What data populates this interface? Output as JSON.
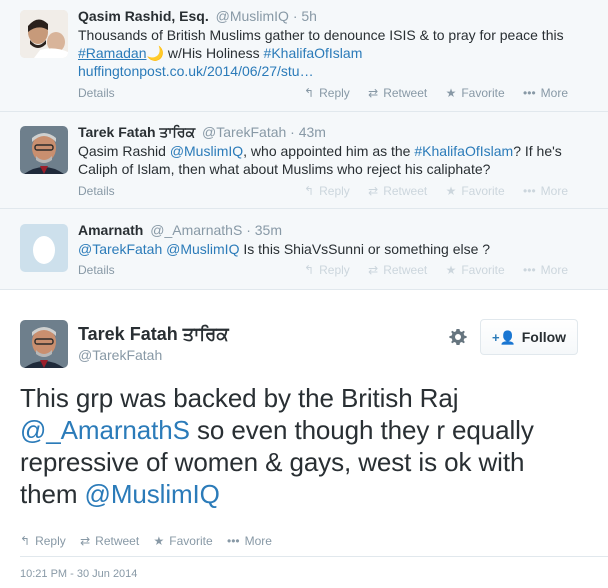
{
  "context_tweets": [
    {
      "fullname": "Qasim Rashid, Esq.",
      "screen_name": "@MuslimIQ",
      "dot": "·",
      "time": "5h",
      "text_before": "Thousands of British Muslims gather to denounce ISIS & to pray for peace this ",
      "hashtag1": "#Ramadan",
      "moon": "🌙",
      "text_mid": " w/His Holiness ",
      "hashtag2": "#KhalifaOfIslam",
      "url": "huffingtonpost.co.uk/2014/06/27/stu…",
      "details": "Details",
      "reply": "Reply",
      "retweet": "Retweet",
      "favorite": "Favorite",
      "more": "More"
    },
    {
      "fullname": "Tarek Fatah ਤਾਰਿਕ",
      "screen_name": "@TarekFatah",
      "dot": "·",
      "time": "43m",
      "text_a": "Qasim Rashid ",
      "mention1": "@MuslimIQ",
      "text_b": ", who appointed him as the ",
      "hashtag1": "#KhalifaOfIslam",
      "text_c": "? If he's Caliph of Islam, then what about Muslims who reject his caliphate?",
      "details": "Details",
      "reply": "Reply",
      "retweet": "Retweet",
      "favorite": "Favorite",
      "more": "More"
    },
    {
      "fullname": "Amarnath",
      "screen_name": "@_AmarnathS",
      "dot": "·",
      "time": "35m",
      "mention1": "@TarekFatah",
      "mention2": "@MuslimIQ",
      "text_a": " Is this ShiaVsSunni or something else ?",
      "details": "Details",
      "reply": "Reply",
      "retweet": "Retweet",
      "favorite": "Favorite",
      "more": "More"
    }
  ],
  "main_tweet": {
    "fullname": "Tarek Fatah ਤਾਰਿਕ",
    "screen_name": "@TarekFatah",
    "follow_label": "Follow",
    "text_a": "This grp was backed by the British Raj ",
    "mention1": "@_AmarnathS",
    "text_b": " so even though they r equally repressive of women & gays, west is ok with them ",
    "mention2": "@MuslimIQ",
    "reply": "Reply",
    "retweet": "Retweet",
    "favorite": "Favorite",
    "more": "More",
    "timestamp": "10:21 PM - 30 Jun 2014"
  },
  "icons": {
    "reply": "reply-icon",
    "retweet": "retweet-icon",
    "favorite": "star-icon",
    "more": "more-dots-icon",
    "gear": "gear-icon",
    "follow": "add-user-icon"
  },
  "colors": {
    "link": "#2b7bb9",
    "muted": "#8899a6",
    "context_bg": "#f5f8fa",
    "text": "#292f33"
  }
}
